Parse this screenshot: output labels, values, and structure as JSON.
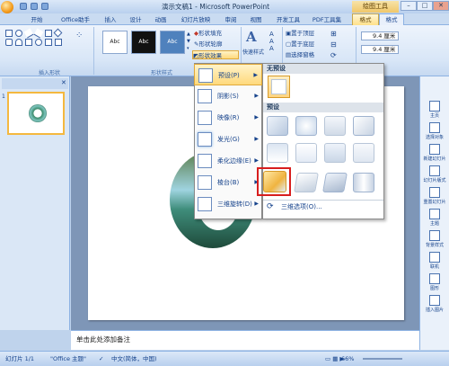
{
  "app": {
    "title": "演示文稿1 - Microsoft PowerPoint",
    "contextual_label": "绘图工具"
  },
  "window_buttons": {
    "minimize": "–",
    "maximize": "□",
    "close": "✕"
  },
  "tabs": [
    "开始",
    "Office助手",
    "插入",
    "设计",
    "动画",
    "幻灯片放映",
    "审阅",
    "视图",
    "开发工具",
    "PDF工具集",
    "格式",
    "格式"
  ],
  "ribbon": {
    "insert_shapes_group": "插入形状",
    "shape_styles_group": "形状样式",
    "style_samples": [
      "Abc",
      "Abc",
      "Abc"
    ],
    "shape_fill": "形状填充",
    "shape_outline": "形状轮廓",
    "shape_effects": "形状效果",
    "quick_styles": "快速样式",
    "bring_front": "置于顶层",
    "send_back": "置于底层",
    "selection_pane": "选择窗格",
    "height_value": "9.4 厘米",
    "width_value": "9.4 厘米"
  },
  "effects_menu": {
    "items": [
      {
        "label": "预设(P)",
        "icon": "preset-icon"
      },
      {
        "label": "阴影(S)",
        "icon": "shadow-icon"
      },
      {
        "label": "映像(R)",
        "icon": "reflection-icon"
      },
      {
        "label": "发光(G)",
        "icon": "glow-icon"
      },
      {
        "label": "柔化边缘(E)",
        "icon": "soft-edges-icon"
      },
      {
        "label": "棱台(B)",
        "icon": "bevel-icon"
      },
      {
        "label": "三维旋转(D)",
        "icon": "3d-rotation-icon"
      }
    ]
  },
  "preset_gallery": {
    "none_header": "无预设",
    "preset_header": "预设",
    "options_link": "三维选项(O)..."
  },
  "notes": {
    "placeholder": "单击此处添加备注"
  },
  "right_panel": [
    "主页",
    "选择对象",
    "新建幻灯片",
    "幻灯片版式",
    "重置幻灯片",
    "主题",
    "背景样式",
    "联机",
    "图形",
    "插入图片"
  ],
  "status": {
    "slide": "幻灯片 1/1",
    "theme": "\"Office 主题\"",
    "language": "中文(简体，中国)",
    "zoom": "66%"
  },
  "left_panel": {
    "slide_number": "1"
  },
  "colors": {
    "accent": "#f4b83f",
    "highlight": "#d81e1e",
    "ribbon": "#d8e6f7"
  }
}
